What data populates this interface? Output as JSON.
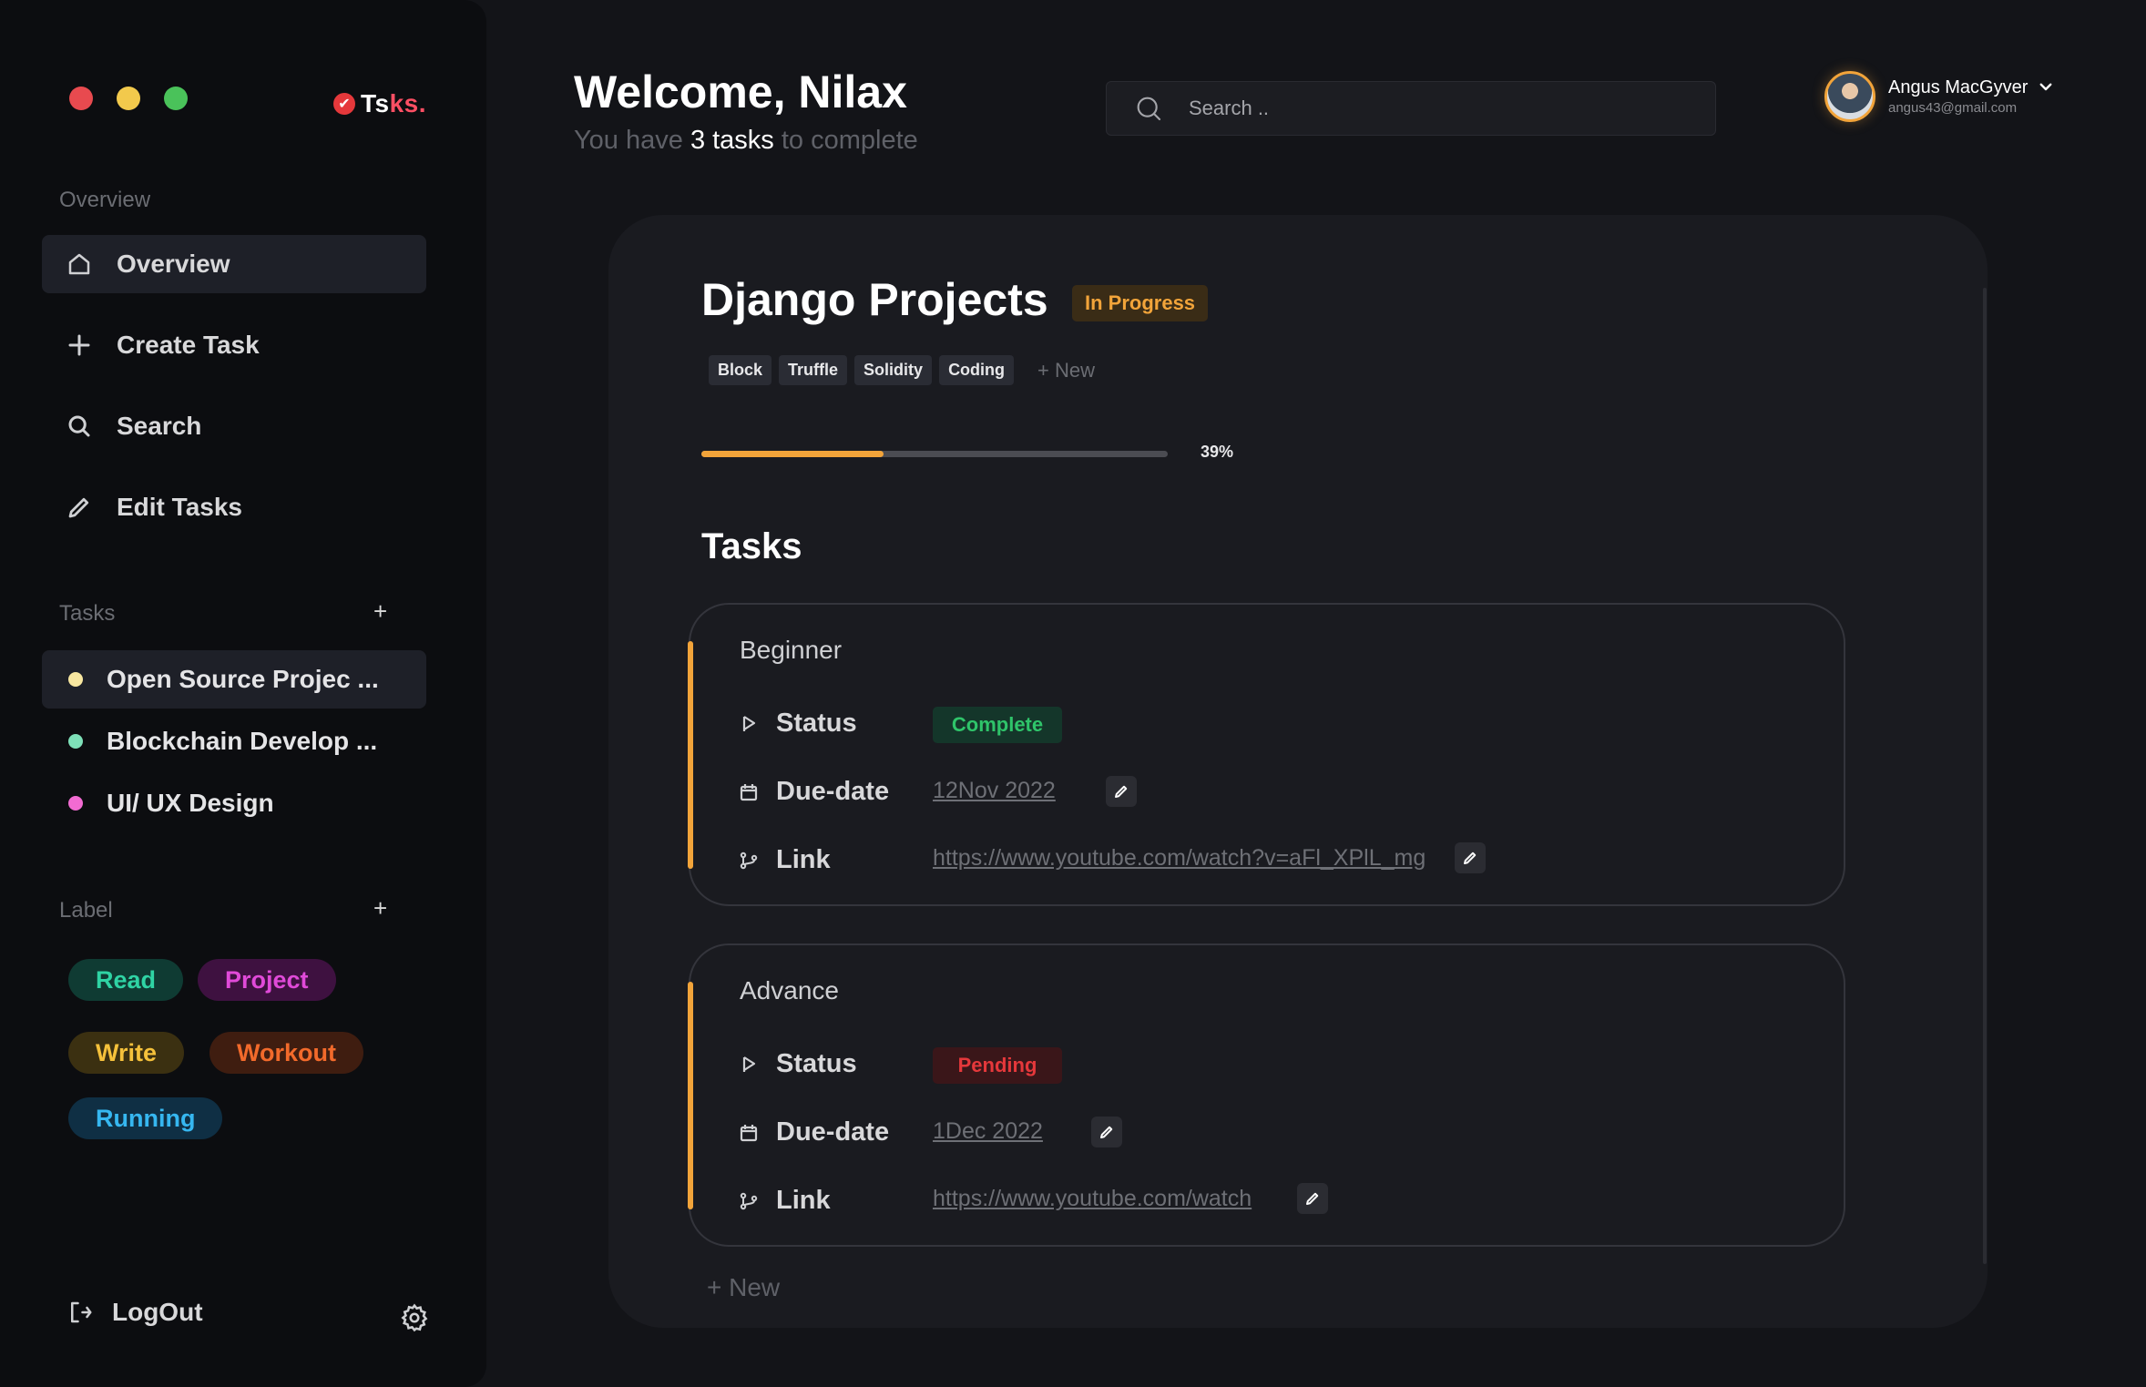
{
  "app": {
    "logo_check": "✔",
    "logo_prefix": "Ts",
    "logo_accent": "ks."
  },
  "sidebar": {
    "overview_label": "Overview",
    "nav": [
      {
        "label": "Overview",
        "icon": "home-icon"
      },
      {
        "label": "Create Task",
        "icon": "plus-icon"
      },
      {
        "label": "Search",
        "icon": "search-icon"
      },
      {
        "label": "Edit Tasks",
        "icon": "pencil-icon"
      }
    ],
    "tasks_label": "Tasks",
    "tasks_add": "+",
    "tasks": [
      {
        "label": "Open Source Projec ...",
        "color": "#f8e7a0"
      },
      {
        "label": "Blockchain Develop ...",
        "color": "#7ee0b8"
      },
      {
        "label": "UI/ UX Design",
        "color": "#f26bd2"
      }
    ],
    "labels_label": "Label",
    "labels_add": "+",
    "labels": [
      {
        "label": "Read",
        "fg": "#2fd3a4",
        "bg": "#0f3b33"
      },
      {
        "label": "Project",
        "fg": "#e04ad8",
        "bg": "#3e1140"
      },
      {
        "label": "Write",
        "fg": "#f5c13b",
        "bg": "#3b3011"
      },
      {
        "label": "Workout",
        "fg": "#f26a2b",
        "bg": "#3f1d10"
      },
      {
        "label": "Running",
        "fg": "#36b7f0",
        "bg": "#0f2f44"
      }
    ],
    "logout_label": "LogOut"
  },
  "header": {
    "welcome": "Welcome, Nilax",
    "subtitle_pre": "You have ",
    "subtitle_count": "3 tasks",
    "subtitle_post": " to complete",
    "search_placeholder": "Search .."
  },
  "user": {
    "name": "Angus MacGyver",
    "email": "angus43@gmail.com"
  },
  "project": {
    "title": "Django Projects",
    "status": "In Progress",
    "tags": [
      "Block",
      "Truffle",
      "Solidity",
      "Coding"
    ],
    "tag_new": "+ New",
    "progress": 0.39,
    "progress_label": "39%",
    "tasks_title": "Tasks",
    "add_new": "+ New"
  },
  "cards": [
    {
      "title": "Beginner",
      "status_key": "Status",
      "status": "Complete",
      "status_fg": "#2fc46a",
      "status_bg": "#14362a",
      "due_key": "Due-date",
      "due": "12Nov 2022",
      "link_key": "Link",
      "link": "https://www.youtube.com/watch?v=aFl_XPlL_mg"
    },
    {
      "title": "Advance",
      "status_key": "Status",
      "status": "Pending",
      "status_fg": "#e5383b",
      "status_bg": "#3a1619",
      "due_key": "Due-date",
      "due": "1Dec 2022",
      "link_key": "Link",
      "link": "https://www.youtube.com/watch"
    }
  ],
  "colors": {
    "accent": "#f2a43a",
    "background": "#131418",
    "sidebar": "#0c0d10",
    "panel": "#1a1b20",
    "traffic": [
      "#e84a4f",
      "#f2c94c",
      "#4ac25a"
    ]
  }
}
